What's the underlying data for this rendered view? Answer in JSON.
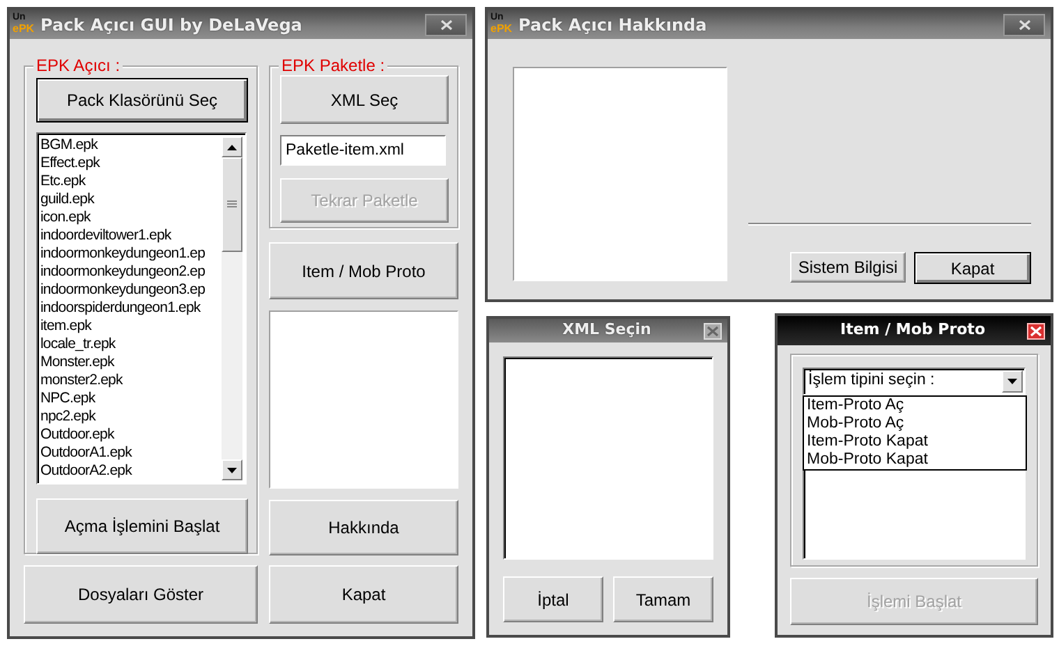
{
  "main_window": {
    "title": "Pack Açıcı GUI by DeLaVega",
    "active": false,
    "logo": {
      "top": "Un",
      "bottom": "ePK"
    },
    "open_group": {
      "legend": "EPK Açıcı :",
      "select_button": {
        "label": "Pack Klasörünü Seç",
        "default": true,
        "disabled": false
      },
      "files": [
        "BGM.epk",
        "Effect.epk",
        "Etc.epk",
        "guild.epk",
        "icon.epk",
        "indoordeviltower1.epk",
        "indoormonkeydungeon1.ep",
        "indoormonkeydungeon2.ep",
        "indoormonkeydungeon3.ep",
        "indoorspiderdungeon1.epk",
        "item.epk",
        "locale_tr.epk",
        "Monster.epk",
        "monster2.epk",
        "NPC.epk",
        "npc2.epk",
        "Outdoor.epk",
        "OutdoorA1.epk",
        "OutdoorA2.epk"
      ],
      "start_button": {
        "label": "Açma İşlemini Başlat",
        "default": false,
        "disabled": false
      }
    },
    "pack_group": {
      "legend": "EPK Paketle :",
      "xml_button": {
        "label": "XML Seç",
        "default": false,
        "disabled": false
      },
      "xml_field": {
        "value": "Paketle-item.xml"
      },
      "repack_button": {
        "label": "Tekrar Paketle",
        "default": false,
        "disabled": true
      }
    },
    "proto_button": {
      "label": "Item / Mob Proto",
      "default": false,
      "disabled": false
    },
    "about_button": {
      "label": "Hakkında",
      "default": false,
      "disabled": false
    },
    "show_files_button": {
      "label": "Dosyaları Göster",
      "default": false,
      "disabled": false
    },
    "close_button": {
      "label": "Kapat",
      "default": false,
      "disabled": false
    }
  },
  "about_window": {
    "title": "Pack Açıcı Hakkında",
    "active": false,
    "logo": {
      "top": "Un",
      "bottom": "ePK"
    },
    "buttons": [
      {
        "label": "Sistem Bilgisi",
        "default": false,
        "disabled": false
      },
      {
        "label": "Kapat",
        "default": true,
        "disabled": false
      }
    ]
  },
  "xml_window": {
    "title": "XML Seçin",
    "active": false,
    "buttons": [
      {
        "label": "İptal",
        "default": false,
        "disabled": false
      },
      {
        "label": "Tamam",
        "default": false,
        "disabled": false
      }
    ]
  },
  "proto_window": {
    "title": "Item / Mob Proto",
    "active": true,
    "combo": {
      "value": "İşlem tipini seçin :",
      "expanded": true,
      "options": [
        "Item-Proto Aç",
        "Mob-Proto Aç",
        "Item-Proto Kapat",
        "Mob-Proto Kapat"
      ]
    },
    "start_button": {
      "label": "İşlemi Başlat",
      "default": false,
      "disabled": true
    }
  }
}
